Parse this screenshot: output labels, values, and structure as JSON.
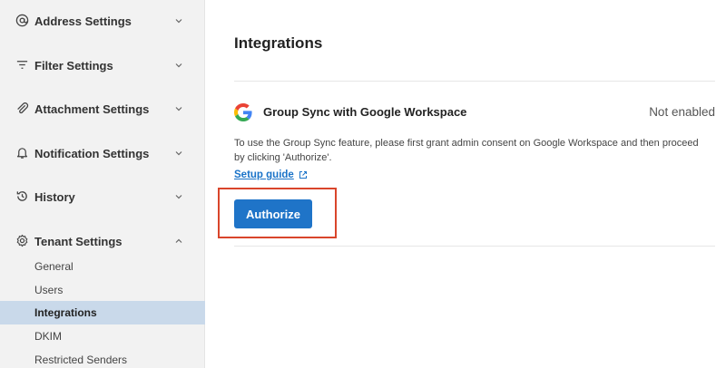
{
  "sidebar": {
    "sections": [
      {
        "label": "Address Settings",
        "icon": "at-icon",
        "expanded": false
      },
      {
        "label": "Filter Settings",
        "icon": "filter-icon",
        "expanded": false
      },
      {
        "label": "Attachment Settings",
        "icon": "paperclip-icon",
        "expanded": false
      },
      {
        "label": "Notification Settings",
        "icon": "bell-icon",
        "expanded": false
      },
      {
        "label": "History",
        "icon": "history-icon",
        "expanded": false
      },
      {
        "label": "Tenant Settings",
        "icon": "gear-icon",
        "expanded": true
      }
    ],
    "tenant_items": [
      "General",
      "Users",
      "Integrations",
      "DKIM",
      "Restricted Senders"
    ],
    "active_item": "Integrations"
  },
  "main": {
    "title": "Integrations",
    "integration": {
      "logo": "google-icon",
      "name": "Group Sync with Google Workspace",
      "status": "Not enabled",
      "description": "To use the Group Sync feature, please first grant admin consent on Google Workspace and then proceed by clicking 'Authorize'.",
      "guide_label": "Setup guide",
      "button_label": "Authorize"
    }
  },
  "colors": {
    "accent": "#1f74c8",
    "active_bg": "#c9d9ea",
    "highlight": "#d9452b"
  }
}
